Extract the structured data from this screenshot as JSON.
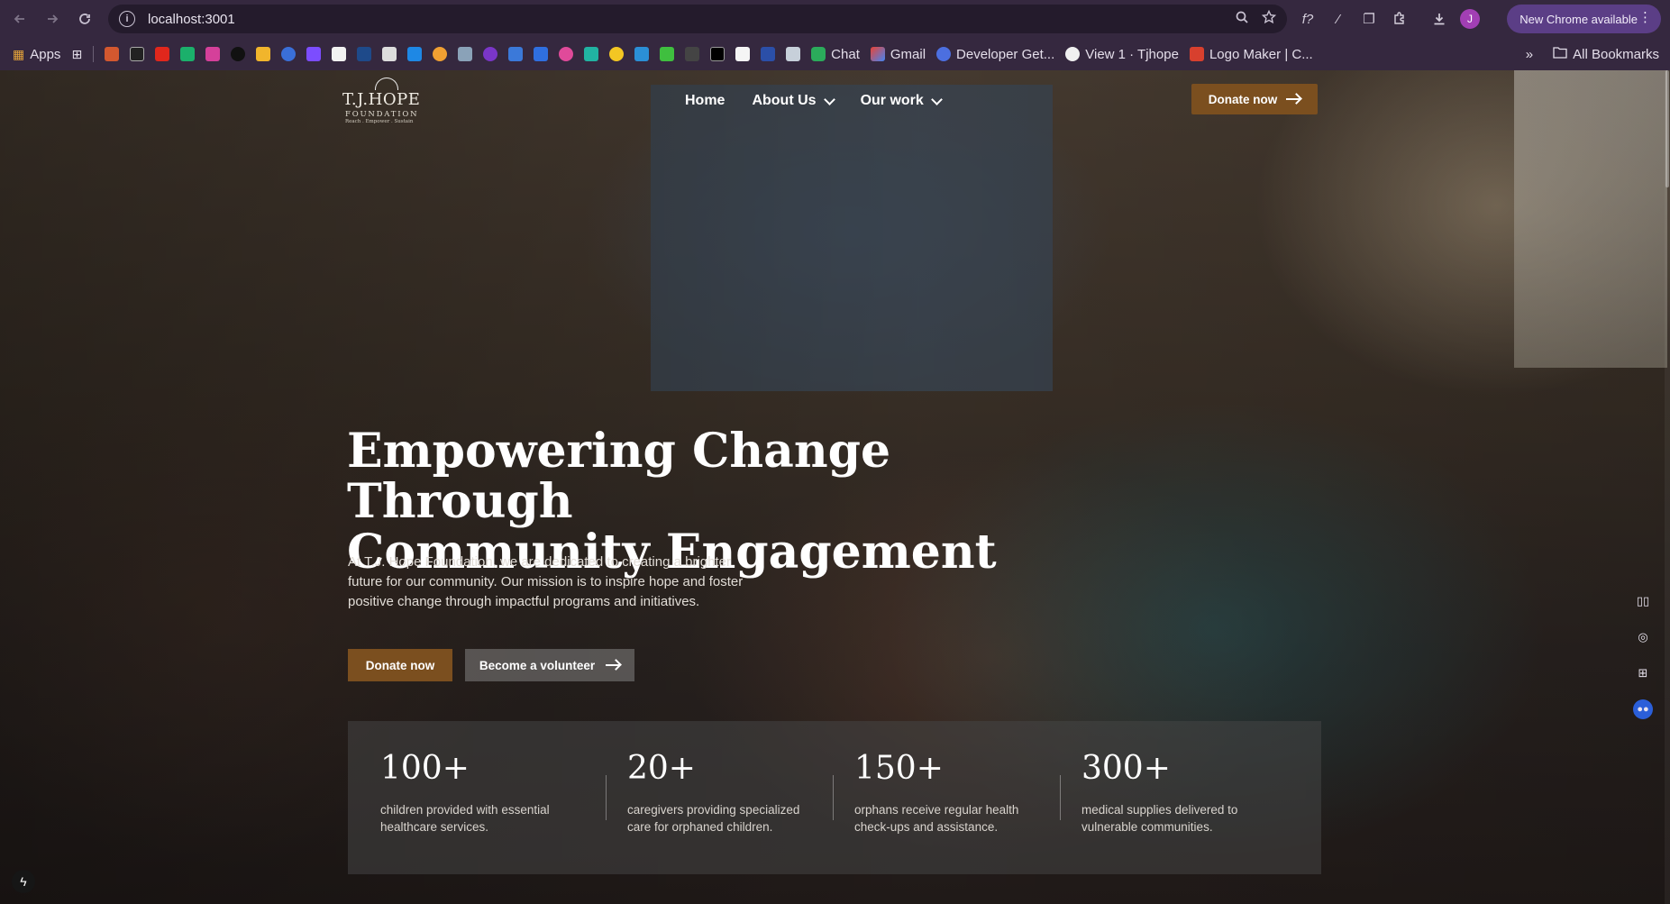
{
  "browser": {
    "url": "localhost:3001",
    "new_chrome_label": "New Chrome available",
    "profile_initial": "J",
    "bookmarks": {
      "apps_label": "Apps",
      "chat_label": "Chat",
      "gmail_label": "Gmail",
      "developer_label": "Developer Get...",
      "view_label": "View 1 · Tjhope",
      "logo_maker_label": "Logo Maker | C...",
      "all_bookmarks_label": "All Bookmarks"
    }
  },
  "site": {
    "logo": {
      "name": "T.J.HOPE",
      "sub": "FOUNDATION",
      "tagline": "Reach . Empower . Sustain"
    },
    "nav": {
      "home": "Home",
      "about": "About Us",
      "work": "Our work"
    },
    "header_cta": "Donate now"
  },
  "hero": {
    "title_line1": "Empowering Change Through",
    "title_line2": "Community Engagement",
    "description": "At T.J. Hope Foundation, we are dedicated to creating a brighter future for our community. Our mission is to inspire hope and foster positive change through impactful programs and initiatives.",
    "primary_cta": "Donate now",
    "secondary_cta": "Become a volunteer"
  },
  "stats": [
    {
      "value": "100+",
      "description": "children provided with essential healthcare services."
    },
    {
      "value": "20+",
      "description": "caregivers providing specialized care for orphaned children."
    },
    {
      "value": "150+",
      "description": "orphans receive regular health check-ups and assistance."
    },
    {
      "value": "300+",
      "description": "medical supplies delivered to vulnerable communities."
    }
  ],
  "colors": {
    "accent": "#7b4f1f",
    "chrome": "#35283f"
  }
}
